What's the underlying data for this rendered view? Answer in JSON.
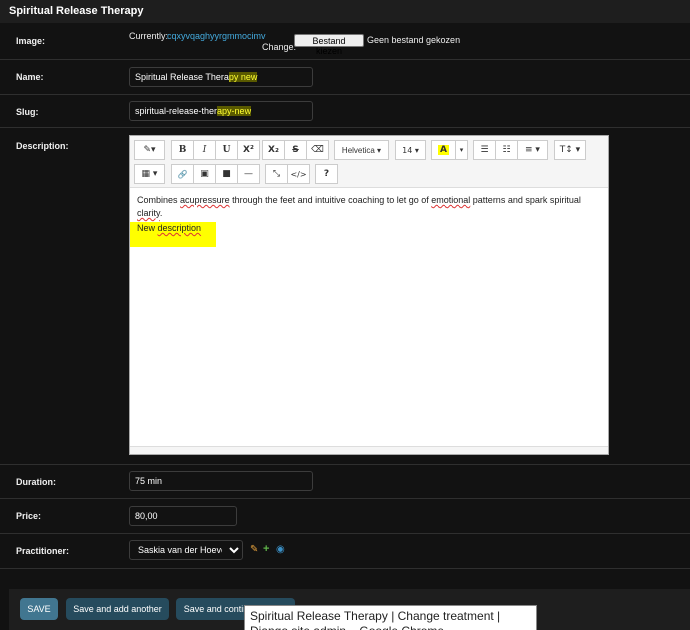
{
  "fieldset": {
    "title": "Spiritual Release Therapy"
  },
  "image": {
    "label": "Image:",
    "currently_label": "Currently:",
    "current_file": "cqxyvqaghyyrgmmocimv",
    "change_label": "Change:",
    "choose_file_button": "Bestand kiezen",
    "no_file_text": "Geen bestand gekozen"
  },
  "name": {
    "label": "Name:",
    "value_prefix": "Spiritual Release Thera",
    "value_highlight": "py new"
  },
  "slug": {
    "label": "Slug:",
    "value_prefix": "spiritual-release-ther",
    "value_highlight": "apy-new"
  },
  "description": {
    "label": "Description:",
    "toolbar": {
      "magic": "✎▾",
      "bold": "B",
      "italic": "I",
      "underline": "U",
      "superscript": "X²",
      "subscript": "X₂",
      "strikethrough": "S",
      "eraser": "⌫",
      "font_family": "Helvetica ▾",
      "font_size": "14 ▾",
      "color": "A",
      "color_dropdown": "▾",
      "ul": "☰",
      "ol": "☷",
      "align": "≡ ▾",
      "line_height": "T↕ ▾",
      "table": "▦ ▾",
      "link": "🔗",
      "picture": "▣",
      "video": "■",
      "hr": "—",
      "fullscreen": "⤡",
      "codeview": "</>",
      "help": "?"
    },
    "content": {
      "paragraph1_words": [
        "Combines",
        "acupressure",
        "through the feet and intuitive coaching to let go of",
        "emotional",
        "patterns and spark spiritual",
        "clarity",
        "."
      ],
      "paragraph2_words": [
        "New",
        "description"
      ]
    }
  },
  "duration": {
    "label": "Duration:",
    "value": "75 min"
  },
  "price": {
    "label": "Price:",
    "value": "80,00"
  },
  "practitioner": {
    "label": "Practitioner:",
    "selected": "Saskia van der Hoeven",
    "edit_icon": "pencil-icon",
    "add_icon": "plus-icon",
    "view_icon": "eye-icon"
  },
  "submit": {
    "save": "SAVE",
    "save_add_another": "Save and add another",
    "save_continue": "Save and continue editing"
  },
  "tooltip": {
    "text": "Spiritual Release Therapy | Change treatment | Django site admin – Google Chrome"
  },
  "colors": {
    "background": "#121212",
    "save_button": "#417690",
    "secondary_button": "#264b5d",
    "link": "#44aadd",
    "highlight": "#ffff00"
  }
}
